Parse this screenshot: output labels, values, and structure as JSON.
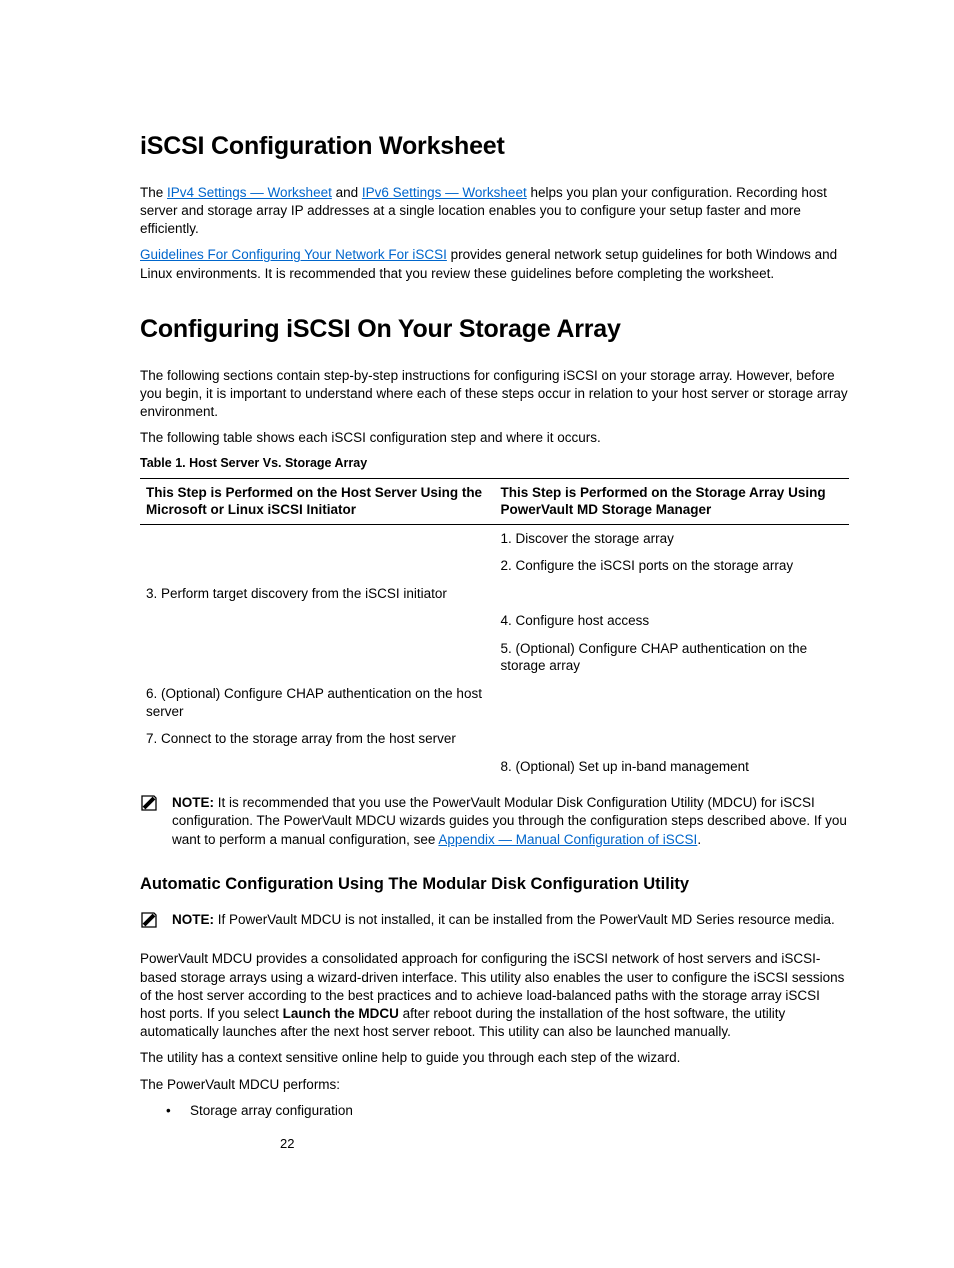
{
  "h1": "iSCSI Configuration Worksheet",
  "p1a": "The ",
  "link1": "IPv4 Settings — Worksheet",
  "p1b": " and ",
  "link2": "IPv6 Settings — Worksheet",
  "p1c": " helps you plan your configuration. Recording host server and storage array IP addresses at a single location enables you to configure your setup faster and more efficiently.",
  "link3": "Guidelines For Configuring Your Network For iSCSI",
  "p2b": " provides general network setup guidelines for both Windows and Linux environments. It is recommended that you review these guidelines before completing the worksheet.",
  "h2": "Configuring iSCSI On Your Storage Array",
  "p3": "The following sections contain step-by-step instructions for configuring iSCSI on your storage array. However, before you begin, it is important to understand where each of these steps occur in relation to your host server or storage array environment.",
  "p4": "The following table shows each iSCSI configuration step and where it occurs.",
  "tableCaption": "Table 1. Host Server Vs. Storage Array",
  "th1": "This Step is Performed on the Host Server Using the Microsoft or Linux iSCSI Initiator",
  "th2": "This Step is Performed on the Storage Array Using PowerVault MD Storage Manager",
  "r1c2": "1. Discover the storage array",
  "r2c2": "2. Configure the iSCSI ports on the storage array",
  "r3c1": "3. Perform target discovery from the iSCSI initiator",
  "r4c2": "4. Configure host access",
  "r5c2": "5. (Optional) Configure CHAP authentication on the storage array",
  "r6c1": "6. (Optional) Configure CHAP authentication on the host server",
  "r7c1": "7. Connect to the storage array from the host server",
  "r8c2": "8. (Optional) Set up in-band management",
  "noteLabel": "NOTE: ",
  "note1a": "It is recommended that you use the PowerVault Modular Disk Configuration Utility (MDCU) for iSCSI configuration. The PowerVault MDCU wizards guides you through the configuration steps described above. If you want to perform a manual configuration, see ",
  "note1link": "Appendix — Manual Configuration of iSCSI",
  "note1b": ".",
  "h3": "Automatic Configuration Using The Modular Disk Configuration Utility",
  "note2": "If PowerVault MDCU is not installed, it can be installed from the PowerVault MD Series resource media.",
  "p5a": "PowerVault MDCU provides a consolidated approach for configuring the iSCSI network of host servers and iSCSI-based storage arrays using a wizard-driven interface. This utility also enables the user to configure the iSCSI sessions of the host server according to the best practices and to achieve load-balanced paths with the storage array iSCSI host ports. If you select ",
  "p5bold": "Launch the MDCU",
  "p5b": " after reboot during the installation of the host software, the utility automatically launches after the next host server reboot. This utility can also be launched manually.",
  "p6": "The utility has a context sensitive online help to guide you through each step of the wizard.",
  "p7": "The PowerVault MDCU performs:",
  "bullet1": "Storage array configuration",
  "pageNum": "22"
}
